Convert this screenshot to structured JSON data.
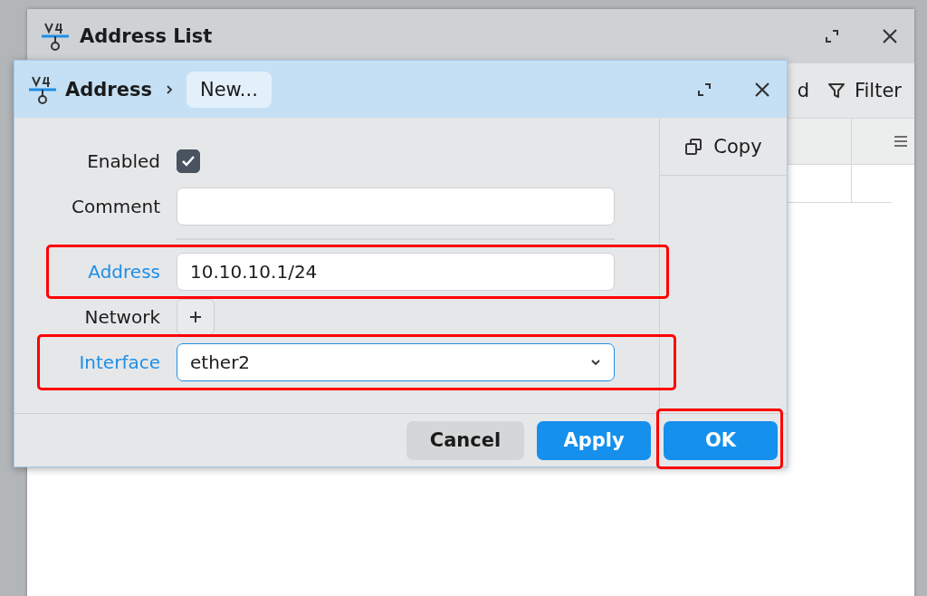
{
  "back_window": {
    "title": "Address List",
    "toolbar": [
      {
        "label": "d",
        "kind": "text"
      },
      {
        "label": "Filter",
        "kind": "filter"
      }
    ]
  },
  "dialog": {
    "title": "Address",
    "breadcrumb": "New...",
    "fields": [
      {
        "label": "Enabled",
        "kind": "checkbox",
        "checked": true,
        "required": false,
        "highlighted": false
      },
      {
        "label": "Comment",
        "kind": "text",
        "required": false,
        "highlighted": false
      },
      {
        "kind": "divider"
      },
      {
        "label": "Address",
        "kind": "text",
        "value": "10.10.10.1/24",
        "required": true,
        "highlighted": true
      },
      {
        "label": "Network",
        "kind": "add",
        "required": false,
        "highlighted": false
      },
      {
        "label": "Interface",
        "kind": "select",
        "value": "ether2",
        "required": true,
        "highlighted": true
      }
    ],
    "side_buttons": [
      {
        "label": "Copy"
      }
    ],
    "buttons": [
      {
        "label": "Cancel",
        "kind": "secondary"
      },
      {
        "label": "Apply",
        "kind": "primary"
      },
      {
        "label": "OK",
        "kind": "primary",
        "highlighted": true
      }
    ]
  }
}
